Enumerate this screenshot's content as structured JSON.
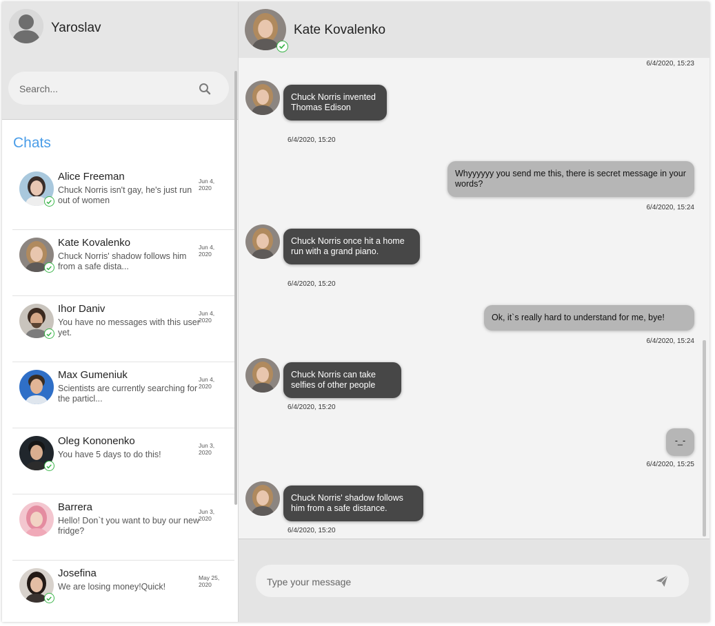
{
  "user": {
    "name": "Yaroslav"
  },
  "search": {
    "placeholder": "Search..."
  },
  "sidebar": {
    "title": "Chats"
  },
  "chats": [
    {
      "name": "Alice Freeman",
      "preview": "Chuck Norris isn't gay, he's just run out of women",
      "date": "Jun 4, 2020",
      "online": true
    },
    {
      "name": "Kate Kovalenko",
      "preview": "Chuck Norris' shadow follows him from a safe dista...",
      "date": "Jun 4, 2020",
      "online": true
    },
    {
      "name": "Ihor Daniv",
      "preview": "You have no messages with this user yet.",
      "date": "Jun 4, 2020",
      "online": true
    },
    {
      "name": "Max Gumeniuk",
      "preview": "Scientists are currently searching for the particl...",
      "date": "Jun 4, 2020",
      "online": false
    },
    {
      "name": "Oleg Kononenko",
      "preview": "You have 5 days to do this!",
      "date": "Jun 3, 2020",
      "online": true
    },
    {
      "name": "Barrera",
      "preview": "Hello! Don`t you want to buy our new fridge?",
      "date": "Jun 3, 2020",
      "online": false
    },
    {
      "name": "Josefina",
      "preview": "We are losing money!Quick!",
      "date": "May 25, 2020",
      "online": true
    }
  ],
  "conversation": {
    "contact_name": "Kate Kovalenko",
    "top_timestamp": "6/4/2020, 15:23",
    "messages": [
      {
        "direction": "in",
        "text": "Chuck Norris invented Thomas Edison",
        "time": "6/4/2020, 15:20"
      },
      {
        "direction": "out",
        "text": "Whyyyyyy you send me this, there is secret message in your words?",
        "time": "6/4/2020, 15:24"
      },
      {
        "direction": "in",
        "text": "Chuck Norris once hit a home run with a grand piano.",
        "time": "6/4/2020, 15:20"
      },
      {
        "direction": "out",
        "text": "Ok, it`s really hard to understand for me, bye!",
        "time": "6/4/2020, 15:24"
      },
      {
        "direction": "in",
        "text": "Chuck Norris can take selfies of other people",
        "time": "6/4/2020, 15:20"
      },
      {
        "direction": "out",
        "text": "-_-",
        "time": "6/4/2020, 15:25"
      },
      {
        "direction": "in",
        "text": "Chuck Norris' shadow follows him from a safe distance.",
        "time": "6/4/2020, 15:20"
      }
    ]
  },
  "composer": {
    "placeholder": "Type your message"
  },
  "colors": {
    "accent": "#4a9de8",
    "online": "#3bb54a",
    "incoming_bubble": "#474747",
    "outgoing_bubble": "#b6b6b6"
  }
}
